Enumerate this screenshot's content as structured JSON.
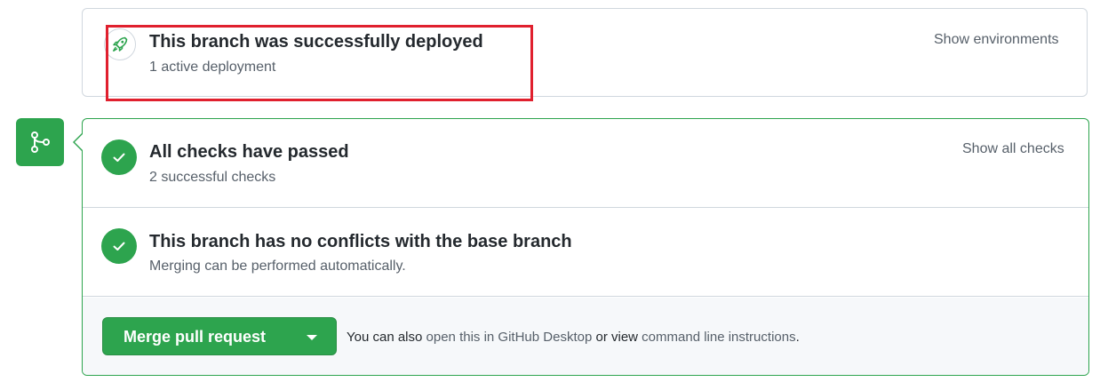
{
  "deployment": {
    "title": "This branch was successfully deployed",
    "subtitle": "1 active deployment",
    "show_environments": "Show environments",
    "icon": "rocket-icon"
  },
  "checks": {
    "title": "All checks have passed",
    "subtitle": "2 successful checks",
    "show_all_checks": "Show all checks",
    "icon": "check-icon"
  },
  "conflicts": {
    "title": "This branch has no conflicts with the base branch",
    "subtitle": "Merging can be performed automatically.",
    "icon": "check-icon"
  },
  "merge": {
    "button_label": "Merge pull request",
    "also_prefix": "You can also ",
    "desktop_link": "open this in GitHub Desktop",
    "or_view": " or view ",
    "cli_link": "command line instructions",
    "period": "."
  },
  "side_icon": "git-merge-icon",
  "colors": {
    "success": "#2da44e",
    "highlight": "#e0202e",
    "muted_text": "#57606a",
    "border": "#d0d7de",
    "footer_bg": "#f6f8fa"
  }
}
